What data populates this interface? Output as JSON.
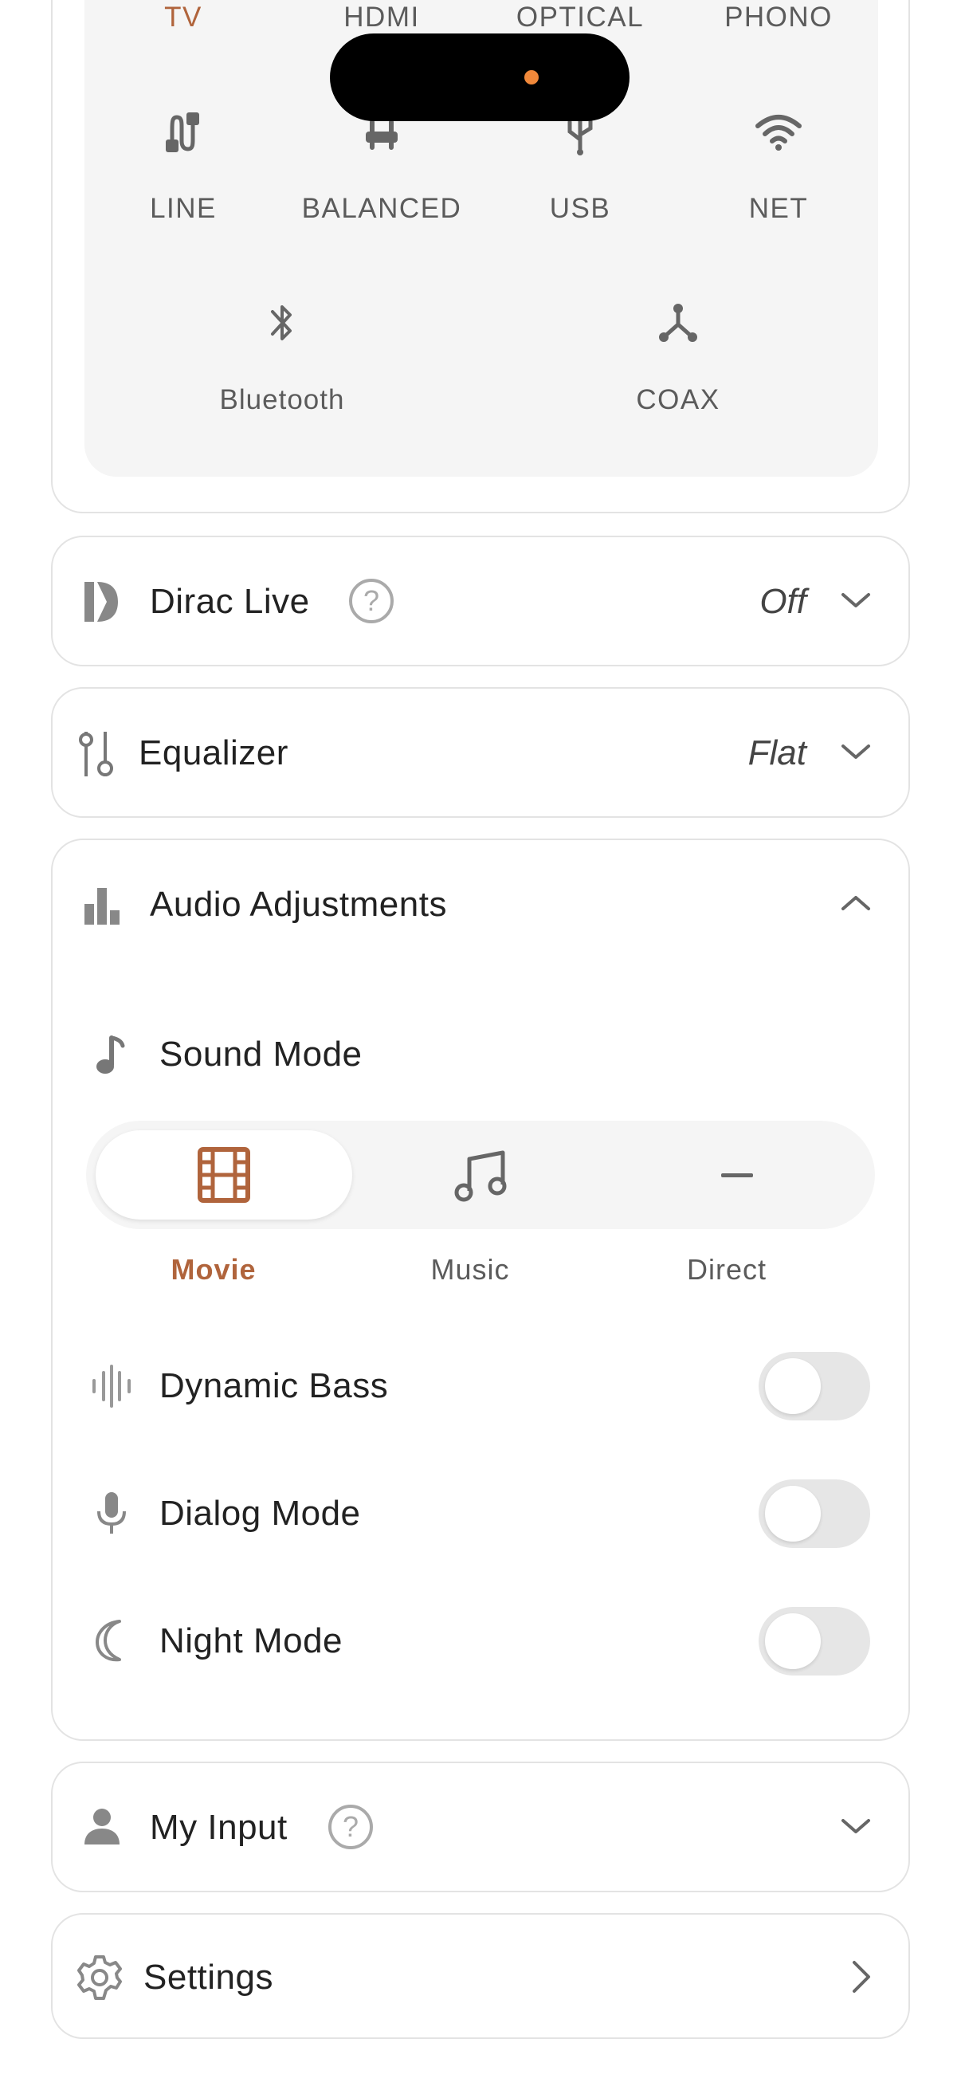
{
  "colors": {
    "accent": "#b0643c",
    "muted": "#5b5b5b",
    "toggle_off": "#e6e6e6",
    "border": "#e3e3e3"
  },
  "inputs": {
    "row1": [
      "TV",
      "HDMI",
      "OPTICAL",
      "PHONO"
    ],
    "row2": [
      "LINE",
      "BALANCED",
      "USB",
      "NET"
    ],
    "row3": [
      "Bluetooth",
      "COAX"
    ],
    "selected": "TV"
  },
  "dirac": {
    "title": "Dirac Live",
    "value": "Off"
  },
  "equalizer": {
    "title": "Equalizer",
    "value": "Flat"
  },
  "audio_adjustments": {
    "title": "Audio Adjustments",
    "sound_mode": {
      "label": "Sound Mode",
      "options": [
        "Movie",
        "Music",
        "Direct"
      ],
      "selected": "Movie"
    },
    "dynamic_bass": "Dynamic Bass",
    "dialog_mode": "Dialog Mode",
    "night_mode": "Night Mode"
  },
  "my_input": {
    "title": "My Input"
  },
  "settings": {
    "title": "Settings"
  }
}
